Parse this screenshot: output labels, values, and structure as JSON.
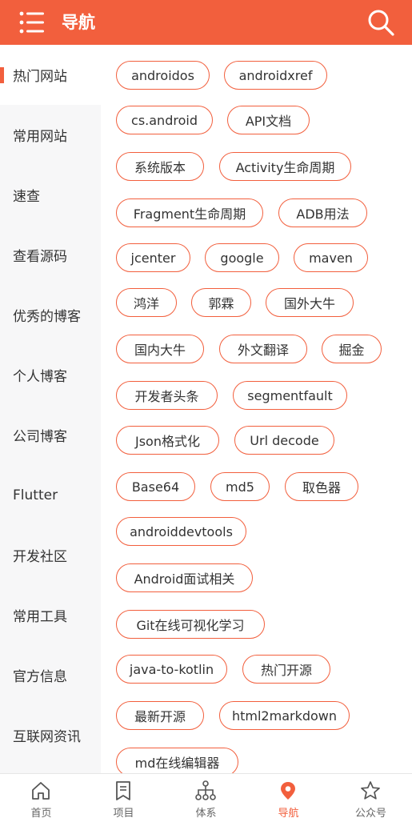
{
  "header": {
    "title": "导航",
    "menu_icon": "menu-icon",
    "search_icon": "search-icon",
    "background": "#f25f3d"
  },
  "sidebar": {
    "items": [
      {
        "label": "热门网站",
        "active": true
      },
      {
        "label": "常用网站"
      },
      {
        "label": "速查"
      },
      {
        "label": "查看源码"
      },
      {
        "label": "优秀的博客"
      },
      {
        "label": "个人博客"
      },
      {
        "label": "公司博客"
      },
      {
        "label": "Flutter"
      },
      {
        "label": "开发社区"
      },
      {
        "label": "常用工具"
      },
      {
        "label": "官方信息"
      },
      {
        "label": "互联网资讯"
      }
    ]
  },
  "tags": [
    "androidos",
    "androidxref",
    "cs.android",
    "API文档",
    "系统版本",
    "Activity生命周期",
    "Fragment生命周期",
    "ADB用法",
    "jcenter",
    "google",
    "maven",
    "鸿洋",
    "郭霖",
    "国外大牛",
    "国内大牛",
    "外文翻译",
    "掘金",
    "开发者头条",
    "segmentfault",
    "Json格式化",
    "Url decode",
    "Base64",
    "md5",
    "取色器",
    "androiddevtools",
    "Android面试相关",
    "Git在线可视化学习",
    "java-to-kotlin",
    "热门开源",
    "最新开源",
    "html2markdown",
    "md在线编辑器"
  ],
  "bottom_nav": {
    "items": [
      {
        "label": "首页",
        "icon": "home-icon"
      },
      {
        "label": "项目",
        "icon": "bookmark-icon"
      },
      {
        "label": "体系",
        "icon": "hierarchy-icon"
      },
      {
        "label": "导航",
        "icon": "location-pin-icon",
        "active": true
      },
      {
        "label": "公众号",
        "icon": "star-icon"
      }
    ]
  },
  "colors": {
    "accent": "#f25f3d",
    "text": "#333333",
    "sidebar_bg": "#f7f7f8"
  }
}
